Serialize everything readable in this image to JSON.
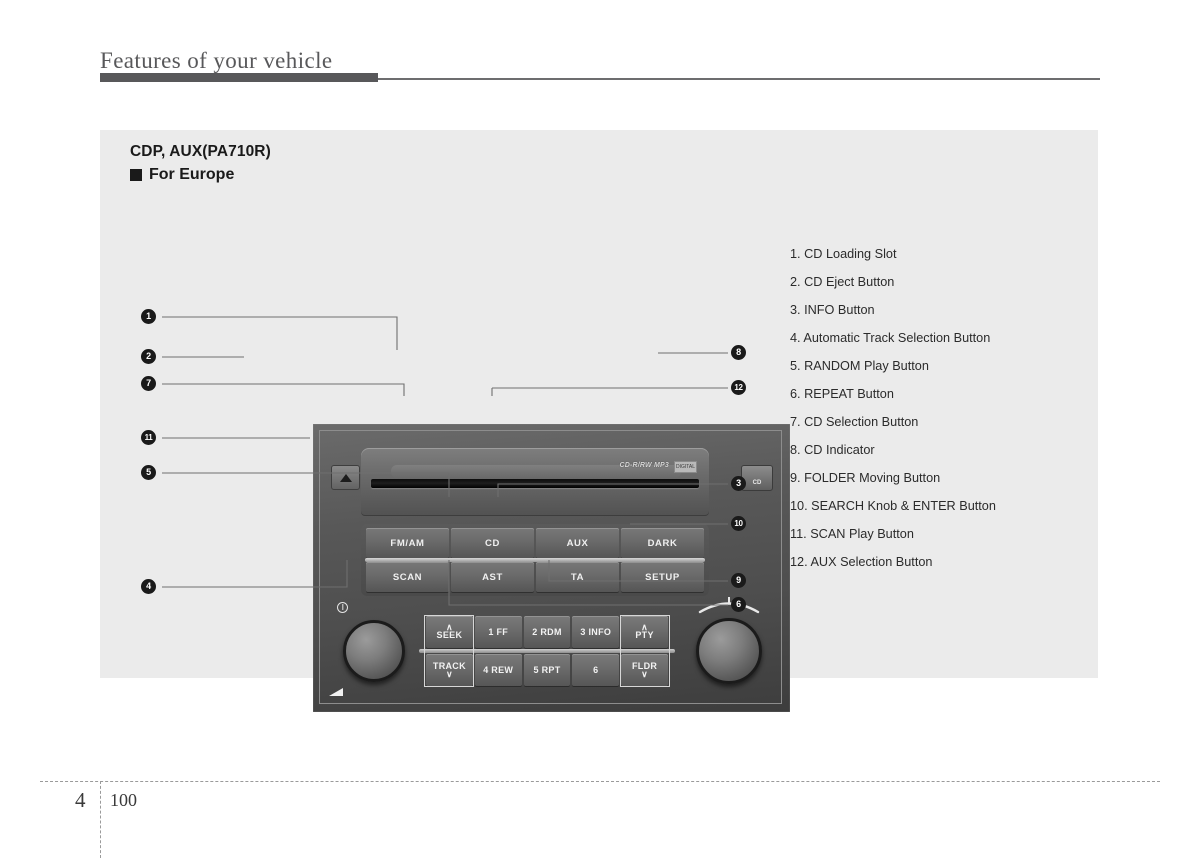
{
  "header": {
    "title": "Features of your vehicle"
  },
  "section": {
    "title": "CDP, AUX(PA710R)",
    "subtitle": "For Europe",
    "bullet_icon": "filled-square-bullet"
  },
  "legend": {
    "items": [
      "1. CD Loading Slot",
      "2. CD Eject Button",
      "3. INFO Button",
      "4. Automatic Track Selection Button",
      "5. RANDOM Play Button",
      "6. REPEAT Button",
      "7. CD Selection Button",
      "8. CD Indicator",
      "9. FOLDER Moving Button",
      "10. SEARCH Knob & ENTER Button",
      "11. SCAN Play Button",
      "12. AUX Selection Button"
    ]
  },
  "radio": {
    "cd_logo_text": "CD-R/RW MP3",
    "cd_logo_mark": "DIGITAL AUDIO",
    "eject_icon": "eject-triangle-icon",
    "cd_indicator_label": "CD",
    "power_icon": "power-icon",
    "volume_mark_icon": "volume-triangle-icon",
    "search_arc_icon": "rotary-arc-icon",
    "button_bank_top": [
      "FM/AM",
      "CD",
      "AUX",
      "DARK"
    ],
    "button_bank_bottom": [
      "SCAN",
      "AST",
      "TA",
      "SETUP"
    ],
    "preset_row_top": [
      {
        "label": "SEEK",
        "arrow": "∧",
        "arrow_pos": "above"
      },
      {
        "label": "1  FF",
        "arrow": "",
        "arrow_pos": ""
      },
      {
        "label": "2 RDM",
        "arrow": "",
        "arrow_pos": ""
      },
      {
        "label": "3 INFO",
        "arrow": "",
        "arrow_pos": ""
      },
      {
        "label": "PTY",
        "arrow": "∧",
        "arrow_pos": "above"
      }
    ],
    "preset_row_bottom": [
      {
        "label": "TRACK",
        "arrow": "∨",
        "arrow_pos": "below"
      },
      {
        "label": "4 REW",
        "arrow": "",
        "arrow_pos": ""
      },
      {
        "label": "5 RPT",
        "arrow": "",
        "arrow_pos": ""
      },
      {
        "label": "6",
        "arrow": "",
        "arrow_pos": ""
      },
      {
        "label": "FLDR",
        "arrow": "∨",
        "arrow_pos": "below"
      }
    ],
    "knobs": {
      "volume_knob": "volume-power-knob",
      "search_knob": "search-enter-knob"
    }
  },
  "callouts": {
    "left": [
      {
        "number": "1",
        "glyph": "❶"
      },
      {
        "number": "2",
        "glyph": "❷"
      },
      {
        "number": "7",
        "glyph": "❼"
      },
      {
        "number": "11",
        "glyph": "➂"
      },
      {
        "number": "5",
        "glyph": "❺"
      },
      {
        "number": "4",
        "glyph": "❹"
      }
    ],
    "right": [
      {
        "number": "8",
        "glyph": "❽"
      },
      {
        "number": "12",
        "glyph": "➃"
      },
      {
        "number": "3",
        "glyph": "❸"
      },
      {
        "number": "10",
        "glyph": "➁"
      },
      {
        "number": "9",
        "glyph": "❾"
      },
      {
        "number": "6",
        "glyph": "❻"
      }
    ]
  },
  "footer": {
    "chapter": "4",
    "page": "100"
  },
  "colors": {
    "page_background": "#ffffff",
    "panel_background": "#ebebeb",
    "header_bar": "#58585a",
    "text_primary": "#1a1a1a",
    "legend_text": "#2b2b2b",
    "callout_marker": "#1a1a1a",
    "callout_line": "#6f6f6f"
  }
}
